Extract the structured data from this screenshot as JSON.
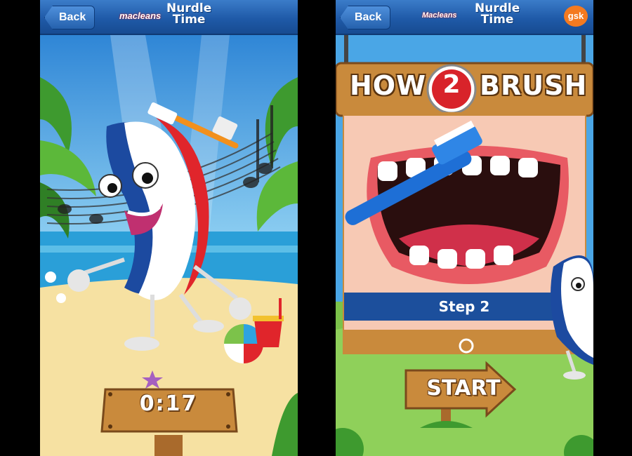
{
  "left_screen": {
    "back_label": "Back",
    "brand": "macleans",
    "title_line1": "Nurdle",
    "title_line2": "Time",
    "timer": "0:17"
  },
  "right_screen": {
    "back_label": "Back",
    "brand": "Macleans",
    "title_line1": "Nurdle",
    "title_line2": "Time",
    "gsk_logo": "gsk",
    "heading_word1": "HOW",
    "heading_number": "2",
    "heading_word2": "BRUSH",
    "step_label": "Step 2",
    "start_label": "START"
  },
  "colors": {
    "navbar_blue": "#1f5aa8",
    "sky_blue": "#4aa6e6",
    "sand": "#f6e1a2",
    "grass": "#7cc24a",
    "wood": "#c98a3c",
    "step_bar": "#1c4f9c"
  },
  "icons": [
    "back-arrow-icon",
    "gsk-logo",
    "clock-number-icon",
    "toothbrush-icon",
    "music-notes-icon"
  ]
}
